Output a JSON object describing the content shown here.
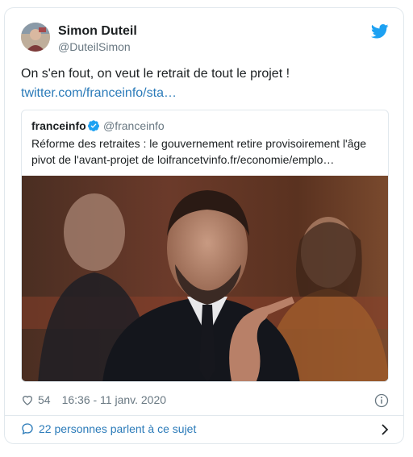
{
  "tweet": {
    "author_name": "Simon Duteil",
    "author_handle": "@DuteilSimon",
    "text": "On s'en fout, on veut le retrait de tout le projet !",
    "link": "twitter.com/franceinfo/sta…"
  },
  "quoted": {
    "name": "franceinfo",
    "handle": "@franceinfo",
    "text": "Réforme des retraites : le gouvernement retire provisoirement l'âge pivot de l'avant-projet de loifrancetvinfo.fr/economie/emplo…"
  },
  "meta": {
    "likes": "54",
    "time": "16:36 - 11 janv. 2020"
  },
  "footer": {
    "conversation": "22 personnes parlent à ce sujet"
  },
  "colors": {
    "link": "#2b7bb9",
    "twitter_blue": "#1da1f2",
    "muted": "#697882",
    "border": "#e1e8ed"
  },
  "icons": [
    "twitter-bird-icon",
    "verified-badge-icon",
    "heart-icon",
    "info-icon",
    "speech-bubble-icon",
    "chevron-right-icon"
  ]
}
